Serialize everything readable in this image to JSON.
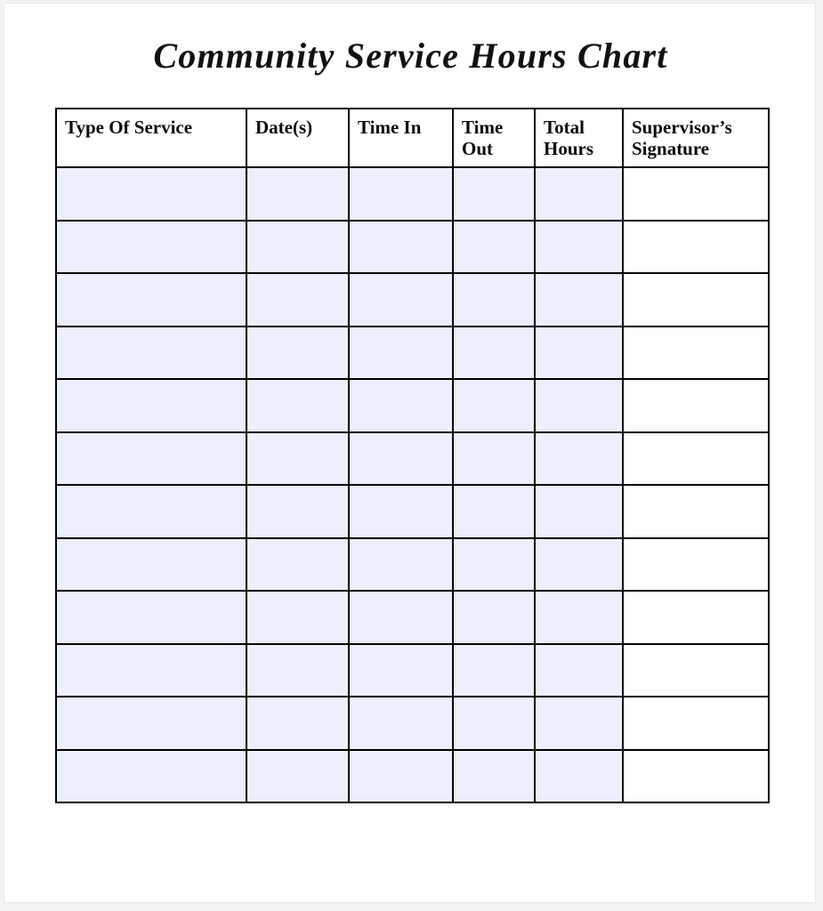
{
  "document": {
    "title": "Community Service Hours Chart"
  },
  "table": {
    "name": "community-service-hours-table",
    "columns": [
      {
        "key": "service",
        "label": "Type Of Service",
        "filled": true
      },
      {
        "key": "dates",
        "label": "Date(s)",
        "filled": true
      },
      {
        "key": "timein",
        "label": "Time In",
        "filled": true
      },
      {
        "key": "timeout",
        "label": "Time Out",
        "filled": true
      },
      {
        "key": "total",
        "label": "Total Hours",
        "filled": true
      },
      {
        "key": "signature",
        "label": "Supervisor’s Signature",
        "filled": false
      }
    ],
    "row_count": 12,
    "rows": [
      {
        "service": "",
        "dates": "",
        "timein": "",
        "timeout": "",
        "total": "",
        "signature": ""
      },
      {
        "service": "",
        "dates": "",
        "timein": "",
        "timeout": "",
        "total": "",
        "signature": ""
      },
      {
        "service": "",
        "dates": "",
        "timein": "",
        "timeout": "",
        "total": "",
        "signature": ""
      },
      {
        "service": "",
        "dates": "",
        "timein": "",
        "timeout": "",
        "total": "",
        "signature": ""
      },
      {
        "service": "",
        "dates": "",
        "timein": "",
        "timeout": "",
        "total": "",
        "signature": ""
      },
      {
        "service": "",
        "dates": "",
        "timein": "",
        "timeout": "",
        "total": "",
        "signature": ""
      },
      {
        "service": "",
        "dates": "",
        "timein": "",
        "timeout": "",
        "total": "",
        "signature": ""
      },
      {
        "service": "",
        "dates": "",
        "timein": "",
        "timeout": "",
        "total": "",
        "signature": ""
      },
      {
        "service": "",
        "dates": "",
        "timein": "",
        "timeout": "",
        "total": "",
        "signature": ""
      },
      {
        "service": "",
        "dates": "",
        "timein": "",
        "timeout": "",
        "total": "",
        "signature": ""
      },
      {
        "service": "",
        "dates": "",
        "timein": "",
        "timeout": "",
        "total": "",
        "signature": ""
      },
      {
        "service": "",
        "dates": "",
        "timein": "",
        "timeout": "",
        "total": "",
        "signature": ""
      }
    ]
  },
  "colors": {
    "page_background": "#ffffff",
    "canvas_background": "#f2f2f2",
    "field_fill": "#eceffc",
    "grid_line": "#000000",
    "text": "#0d0d0d"
  }
}
